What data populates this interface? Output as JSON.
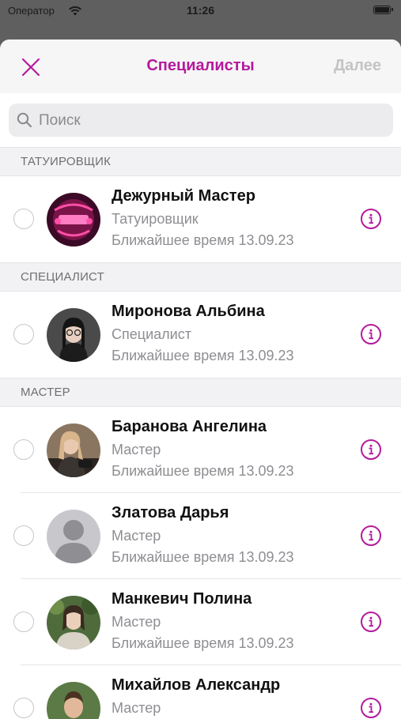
{
  "status_bar": {
    "carrier": "Оператор",
    "time": "11:26"
  },
  "nav": {
    "title": "Специалисты",
    "next_label": "Далее"
  },
  "search": {
    "placeholder": "Поиск"
  },
  "colors": {
    "accent": "#b41a9c",
    "disabled": "#c4c4c4"
  },
  "sections": [
    {
      "header": "ТАТУИРОВЩИК",
      "items": [
        {
          "name": "Дежурный Мастер",
          "role": "Татуировщик",
          "nearest": "Ближайшее время 13.09.23"
        }
      ]
    },
    {
      "header": "СПЕЦИАЛИСТ",
      "items": [
        {
          "name": "Миронова Альбина",
          "role": "Специалист",
          "nearest": "Ближайшее время 13.09.23"
        }
      ]
    },
    {
      "header": "МАСТЕР",
      "items": [
        {
          "name": "Баранова Ангелина",
          "role": "Мастер",
          "nearest": "Ближайшее время 13.09.23"
        },
        {
          "name": "Златова Дарья",
          "role": "Мастер",
          "nearest": "Ближайшее время 13.09.23"
        },
        {
          "name": "Манкевич Полина",
          "role": "Мастер",
          "nearest": "Ближайшее время 13.09.23"
        },
        {
          "name": "Михайлов Александр",
          "role": "Мастер",
          "nearest": ""
        }
      ]
    }
  ]
}
